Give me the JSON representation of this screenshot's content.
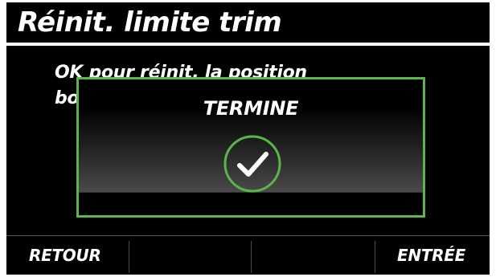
{
  "screen": {
    "title": "Réinit. limite trim",
    "body_text": "OK pour réinit. la position\nbo"
  },
  "dialog": {
    "title": "TERMINE",
    "icon": "checkmark-circle-icon",
    "border_color": "#5ab54a"
  },
  "softkeys": {
    "left_label": "RETOUR",
    "right_label": "ENTRÉE"
  }
}
